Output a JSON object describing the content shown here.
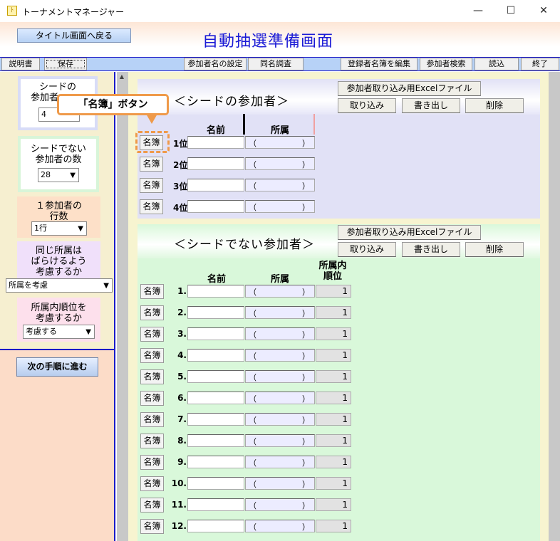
{
  "window": {
    "title": "トーナメントマネージャー",
    "icon_glyph": "ﾄ",
    "minimize": "—",
    "maximize": "☐",
    "close": "✕"
  },
  "header": {
    "back_button": "タイトル画面へ戻る",
    "page_title": "自動抽選準備画面"
  },
  "toolbar": {
    "manual": "説明書",
    "save": "保存",
    "participant_name_settings": "参加者名の設定",
    "same_name_check": "同名調査",
    "edit_register": "登録者名簿を編集",
    "participant_search": "参加者検索",
    "load": "読込",
    "exit": "終了"
  },
  "left": {
    "seed_count_label": "シードの参加者数",
    "seed_count_label_visible_1": "シードの",
    "seed_count_label_visible_2": "参加者",
    "seed_count_value": "4",
    "nonseed_count_label_1": "シードでない",
    "nonseed_count_label_2": "参加者の数",
    "nonseed_count_value": "28",
    "rows_label_1": "１参加者の",
    "rows_label_2": "行数",
    "rows_value": "1行",
    "same_aff_label_1": "同じ所属は",
    "same_aff_label_2": "ばらけるよう",
    "same_aff_label_3": "考慮するか",
    "same_aff_value": "所属を考慮",
    "order_label_1": "所属内順位を",
    "order_label_2": "考慮するか",
    "order_value": "考慮する",
    "next_button": "次の手順に進む"
  },
  "seed": {
    "title": "＜シードの参加者＞",
    "excel_button": "参加者取り込み用Excelファイル",
    "import_button": "取り込み",
    "export_button": "書き出し",
    "delete_button": "削除",
    "col_name": "名前",
    "col_aff": "所属",
    "rows": [
      {
        "btn": "名簿",
        "rank": "1位",
        "name": "",
        "aff_open": "（",
        "aff_close": "）"
      },
      {
        "btn": "名簿",
        "rank": "2位",
        "name": "",
        "aff_open": "（",
        "aff_close": "）"
      },
      {
        "btn": "名簿",
        "rank": "3位",
        "name": "",
        "aff_open": "（",
        "aff_close": "）"
      },
      {
        "btn": "名簿",
        "rank": "4位",
        "name": "",
        "aff_open": "（",
        "aff_close": "）"
      }
    ]
  },
  "nonseed": {
    "title": "＜シードでない参加者＞",
    "excel_button": "参加者取り込み用Excelファイル",
    "import_button": "取り込み",
    "export_button": "書き出し",
    "delete_button": "削除",
    "col_name": "名前",
    "col_aff": "所属",
    "col_order_1": "所属内",
    "col_order_2": "順位",
    "rows": [
      {
        "btn": "名簿",
        "num": "1.",
        "aff_open": "（",
        "aff_close": "）",
        "order": "1"
      },
      {
        "btn": "名簿",
        "num": "2.",
        "aff_open": "（",
        "aff_close": "）",
        "order": "1"
      },
      {
        "btn": "名簿",
        "num": "3.",
        "aff_open": "（",
        "aff_close": "）",
        "order": "1"
      },
      {
        "btn": "名簿",
        "num": "4.",
        "aff_open": "（",
        "aff_close": "）",
        "order": "1"
      },
      {
        "btn": "名簿",
        "num": "5.",
        "aff_open": "（",
        "aff_close": "）",
        "order": "1"
      },
      {
        "btn": "名簿",
        "num": "6.",
        "aff_open": "（",
        "aff_close": "）",
        "order": "1"
      },
      {
        "btn": "名簿",
        "num": "7.",
        "aff_open": "（",
        "aff_close": "）",
        "order": "1"
      },
      {
        "btn": "名簿",
        "num": "8.",
        "aff_open": "（",
        "aff_close": "）",
        "order": "1"
      },
      {
        "btn": "名簿",
        "num": "9.",
        "aff_open": "（",
        "aff_close": "）",
        "order": "1"
      },
      {
        "btn": "名簿",
        "num": "10.",
        "aff_open": "（",
        "aff_close": "）",
        "order": "1"
      },
      {
        "btn": "名簿",
        "num": "11.",
        "aff_open": "（",
        "aff_close": "）",
        "order": "1"
      },
      {
        "btn": "名簿",
        "num": "12.",
        "aff_open": "（",
        "aff_close": "）",
        "order": "1"
      }
    ]
  },
  "callout": {
    "text": "「名簿」ボタン"
  },
  "icons": {
    "dropdown": "▼",
    "scroll_up": "▲"
  },
  "colors": {
    "title_blue": "#1b1bd6",
    "seed_bg": "#e1e1f6",
    "nonseed_bg": "#d9f8da",
    "callout_orange": "#ef9a4a",
    "left_lower_bg": "#fcdcc8"
  }
}
